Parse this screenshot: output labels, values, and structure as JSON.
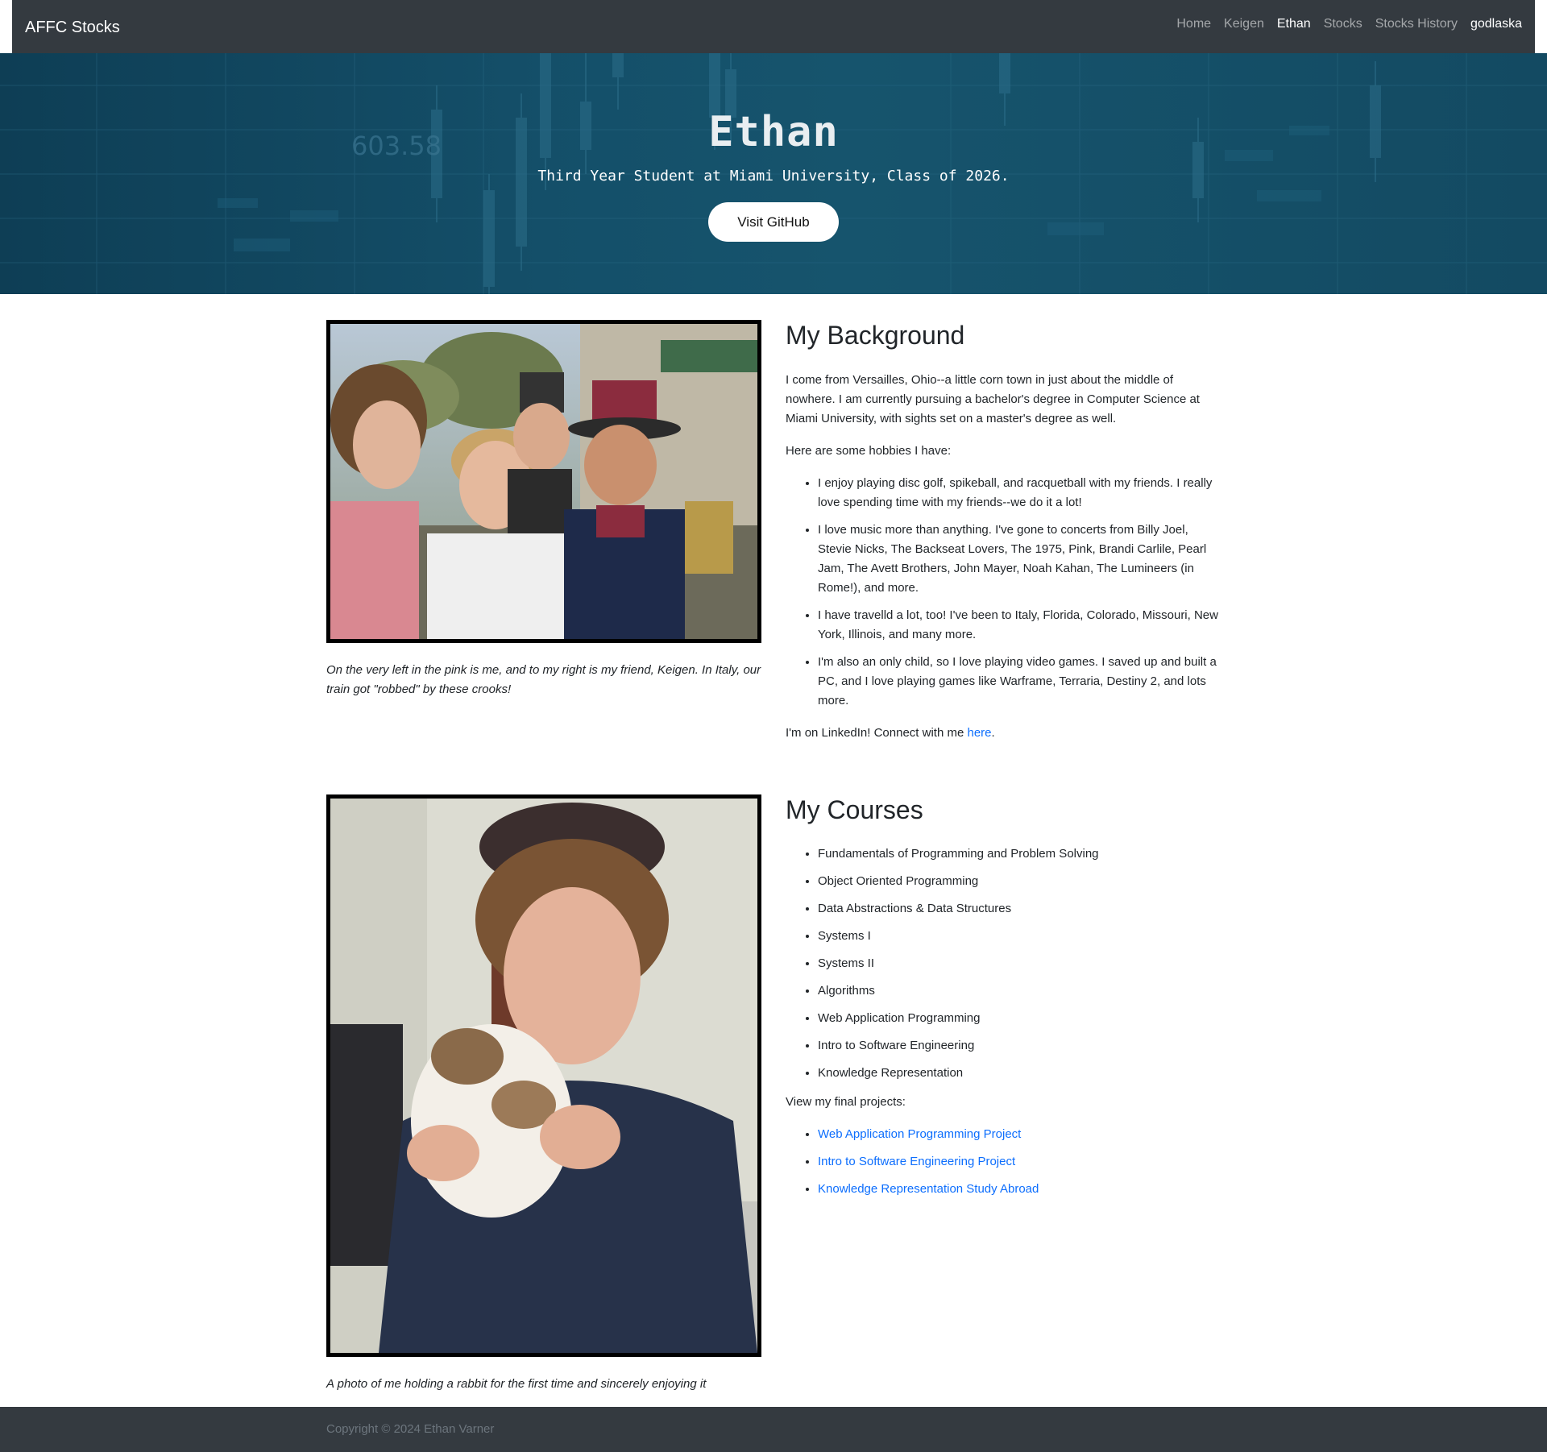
{
  "navbar": {
    "brand": "AFFC Stocks",
    "links": [
      "Home",
      "Keigen",
      "Ethan",
      "Stocks",
      "Stocks History"
    ],
    "active": "Ethan",
    "user": "godlaska"
  },
  "hero": {
    "title": "Ethan",
    "subtitle": "Third Year Student at Miami University, Class of 2026.",
    "button": "Visit GitHub",
    "bg_ticker_text": "603.58"
  },
  "background": {
    "photo_caption": "On the very left in the pink is me, and to my right is my friend, Keigen. In Italy, our train got \"robbed\" by these crooks!",
    "heading": "My Background",
    "intro": "I come from Versailles, Ohio--a little corn town in just about the middle of nowhere. I am currently pursuing a bachelor's degree in Computer Science at Miami University, with sights set on a master's degree as well.",
    "hobbies_lead": "Here are some hobbies I have:",
    "hobbies": [
      "I enjoy playing disc golf, spikeball, and racquetball with my friends. I really love spending time with my friends--we do it a lot!",
      "I love music more than anything. I've gone to concerts from Billy Joel, Stevie Nicks, The Backseat Lovers, The 1975, Pink, Brandi Carlile, Pearl Jam, The Avett Brothers, John Mayer, Noah Kahan, The Lumineers (in Rome!), and more.",
      "I have travelld a lot, too! I've been to Italy, Florida, Colorado, Missouri, New York, Illinois, and many more.",
      "I'm also an only child, so I love playing video games. I saved up and built a PC, and I love playing games like Warframe, Terraria, Destiny 2, and lots more."
    ],
    "linkedin_prefix": "I'm on LinkedIn! Connect with me ",
    "linkedin_link": "here",
    "linkedin_suffix": "."
  },
  "courses": {
    "photo_caption": "A photo of me holding a rabbit for the first time and sincerely enjoying it",
    "heading": "My Courses",
    "list": [
      "Fundamentals of Programming and Problem Solving",
      "Object Oriented Programming",
      "Data Abstractions & Data Structures",
      "Systems I",
      "Systems II",
      "Algorithms",
      "Web Application Programming",
      "Intro to Software Engineering",
      "Knowledge Representation"
    ],
    "projects_lead": "View my final projects:",
    "projects": [
      "Web Application Programming Project",
      "Intro to Software Engineering Project",
      "Knowledge Representation Study Abroad"
    ]
  },
  "footer": {
    "copyright": "Copyright © 2024 Ethan Varner"
  },
  "colors": {
    "navbar": "#343a40",
    "hero_bg": "#144f69",
    "link": "#0d6efd",
    "footer": "#343a40"
  }
}
